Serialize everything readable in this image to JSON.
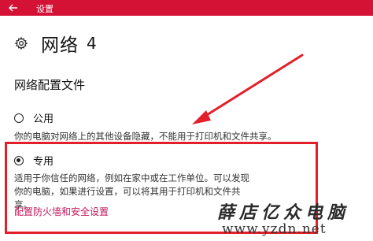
{
  "window": {
    "title": "设置"
  },
  "page": {
    "title": "网络",
    "number": "4"
  },
  "section": {
    "title": "网络配置文件"
  },
  "profiles": {
    "public": {
      "label": "公用",
      "description": "你的电脑对网络上的其他设备隐藏，不能用于打印机和文件共享。",
      "selected": false
    },
    "private": {
      "label": "专用",
      "description": "适用于你信任的网络，例如在家中或在工作单位。可以发现你的电脑，如果进行设置，可以将其用于打印机和文件共享。",
      "selected": true
    }
  },
  "links": {
    "firewall": "配置防火墙和安全设置"
  },
  "watermark": {
    "name": "薛店亿众电脑",
    "url": "www.yzdn.net"
  },
  "colors": {
    "accent": "#d41236",
    "annotation": "#e3202a",
    "link": "#c2185b"
  },
  "icons": {
    "back": "back-arrow-icon",
    "settings": "gear-icon"
  }
}
